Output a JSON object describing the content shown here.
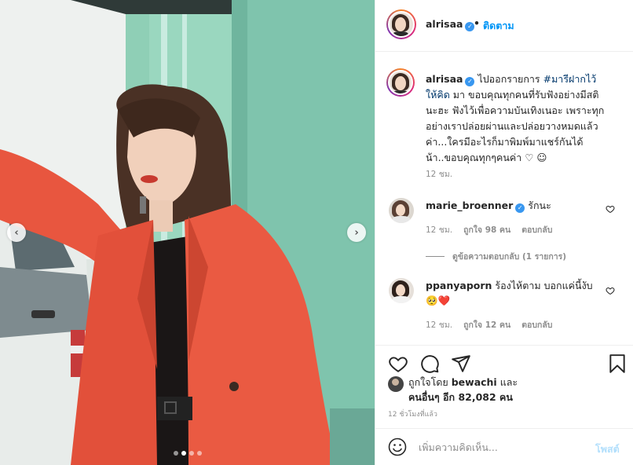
{
  "photo": {
    "prev_icon": "chevron-left-icon",
    "next_icon": "chevron-right-icon",
    "prev_glyph": "‹",
    "next_glyph": "›",
    "slide_count": 4,
    "active_slide": 1
  },
  "header": {
    "username": "alrisaa",
    "verified_glyph": "✓",
    "separator": "•",
    "follow_label": "ติดตาม"
  },
  "caption": {
    "username": "alrisaa",
    "text_before": " ไปออกรายการ ",
    "hashtag": "#มารีฝากไว้ให้คิด",
    "text_after": " มา ขอบคุณทุกคนที่รับฟังอย่างมีสตินะฮะ ฟังไว้เพื่อความบันเทิงเนอะ เพราะทุกอย่างเราปล่อยผ่านและปล่อยวางหมดแล้วค่า...ใครมีอะไรก็มาพิมพ์มาแชร์กันได้น้า..ขอบคุณทุกๆคนค่า ♡ ☺",
    "time": "12 ชม."
  },
  "comments": [
    {
      "username": "marie_broenner",
      "text": "รักนะ",
      "time": "12 ชม.",
      "likes": "ถูกใจ 98 คน",
      "reply": "ตอบกลับ",
      "view_replies": "ดูข้อความตอบกลับ (1 รายการ)"
    },
    {
      "username": "ppanyaporn",
      "text": "ร้องไห้ตาม บอกแค่นี้งับ 🥺❤️",
      "time": "12 ชม.",
      "likes": "ถูกใจ 12 คน",
      "reply": "ตอบกลับ"
    }
  ],
  "actions": {
    "liked_by_prefix": "ถูกใจโดย",
    "liked_by_user": "bewachi",
    "and": "และ",
    "others": "คนอื่นๆ อีก 82,082 คน",
    "post_time": "12 ชั่วโมงที่แล้ว"
  },
  "add_comment": {
    "placeholder": "เพิ่มความคิดเห็น...",
    "post_label": "โพสต์"
  },
  "colors": {
    "accent": "#0095f6",
    "hashtag": "#00376b",
    "muted": "#8e8e8e",
    "jacket": "#e8563f",
    "wall": "#7fc4ad"
  }
}
